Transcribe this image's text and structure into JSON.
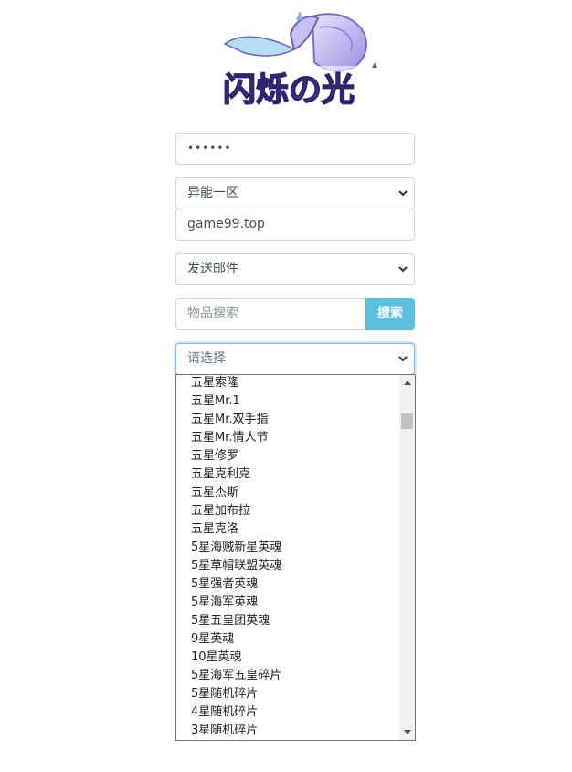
{
  "logo": {
    "title": "闪烁の光"
  },
  "form": {
    "password_value": "••••••",
    "server_select": {
      "selected": "异能一区"
    },
    "site_value": "game99.top",
    "action_select": {
      "selected": "发送邮件"
    },
    "search": {
      "placeholder": "物品搜索",
      "button_label": "搜索"
    },
    "item_select": {
      "selected": "请选择"
    }
  },
  "dropdown": {
    "items": [
      "五星索隆",
      "五星Mr.1",
      "五星Mr.双手指",
      "五星Mr.情人节",
      "五星修罗",
      "五星克利克",
      "五星杰斯",
      "五星加布拉",
      "五星克洛",
      "5星海贼新星英魂",
      "5星草帽联盟英魂",
      "5星强者英魂",
      "5星海军英魂",
      "5星五皇团英魂",
      "9星英魂",
      "10星英魂",
      "5星海军五皇碎片",
      "5星随机碎片",
      "4星随机碎片",
      "3星随机碎片"
    ]
  },
  "colors": {
    "accent": "#5bc0de",
    "focus_border": "#80bdff",
    "logo_purple": "#5a4fb0"
  },
  "icons": [
    "chevron-down-icon",
    "scroll-up-arrow-icon",
    "scroll-down-arrow-icon",
    "crystal-creature-logo"
  ]
}
